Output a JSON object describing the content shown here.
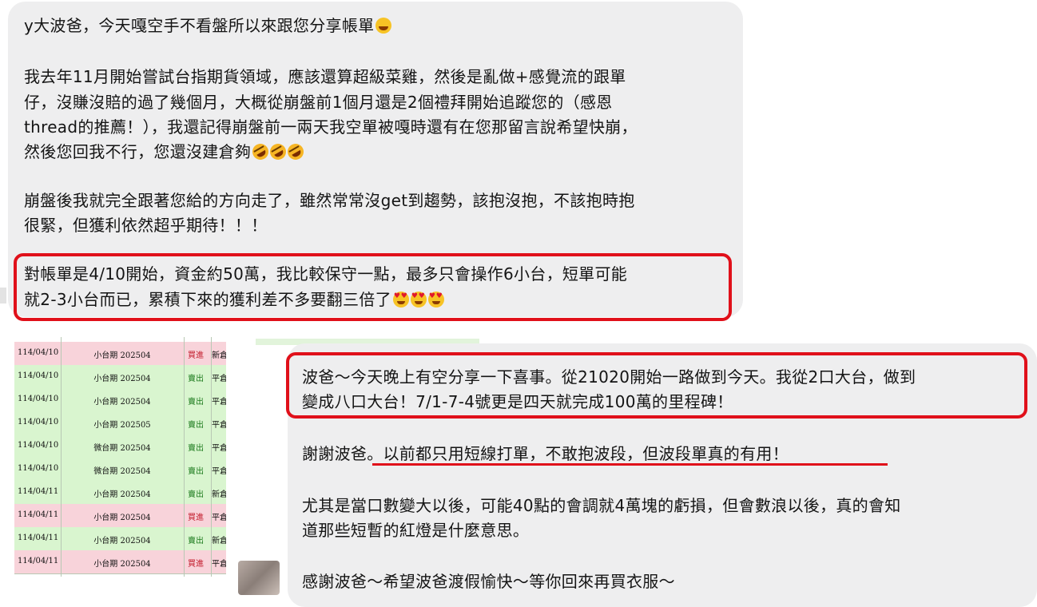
{
  "message1": {
    "lines": [
      "y大波爸，今天嘎空手不看盤所以來跟您分享帳單",
      "我去年11月開始嘗試台指期貨領域，應該還算超級菜雞，然後是亂做+感覺流的跟單",
      "仔，沒賺沒賠的過了幾個月，大概從崩盤前1個月還是2個禮拜開始追蹤您的（感恩",
      "thread的推薦！），我還記得崩盤前一兩天我空單被嘎時還有在您那留言說希望快崩，",
      "然後您回我不行，您還沒建倉夠",
      "崩盤後我就完全跟著您給的方向走了，雖然常常沒get到趨勢，該抱沒抱，不該抱時抱",
      "很緊，但獲利依然超乎期待！！！",
      "對帳單是4/10開始，資金約50萬，我比較保守一點，最多只會操作6小台，短單可能",
      "就2-3小台而已，累積下來的獲利差不多要翻三倍了"
    ]
  },
  "message2": {
    "lines": [
      "波爸～今天晚上有空分享一下喜事。從21020開始一路做到今天。我從2口大台，做到",
      "變成八口大台！7/1-7-4號更是四天就完成100萬的里程碑！",
      "謝謝波爸。以前都只用短線打單，不敢抱波段，但波段單真的有用！",
      "尤其是當口數變大以後，可能40點的會調就4萬塊的虧損，但會數浪以後，真的會知",
      "道那些短暫的紅燈是什麼意思。",
      "感謝波爸～希望波爸渡假愉快～等你回來再買衣服～"
    ]
  },
  "sheet": {
    "rows": [
      {
        "date": "114/04/10",
        "product": "小台期 202504",
        "side": "買進",
        "kind": "新倉",
        "color": "pink"
      },
      {
        "date": "114/04/10",
        "product": "小台期 202504",
        "side": "賣出",
        "kind": "平倉",
        "color": "green"
      },
      {
        "date": "114/04/10",
        "product": "小台期 202504",
        "side": "賣出",
        "kind": "平倉",
        "color": "green"
      },
      {
        "date": "114/04/10",
        "product": "小台期 202505",
        "side": "賣出",
        "kind": "平倉",
        "color": "green"
      },
      {
        "date": "114/04/10",
        "product": "微台期 202504",
        "side": "賣出",
        "kind": "平倉",
        "color": "green"
      },
      {
        "date": "114/04/10",
        "product": "微台期 202504",
        "side": "賣出",
        "kind": "平倉",
        "color": "green"
      },
      {
        "date": "114/04/11",
        "product": "小台期 202504",
        "side": "賣出",
        "kind": "新倉",
        "color": "green"
      },
      {
        "date": "114/04/11",
        "product": "小台期 202504",
        "side": "買進",
        "kind": "平倉",
        "color": "pink"
      },
      {
        "date": "114/04/11",
        "product": "小台期 202504",
        "side": "賣出",
        "kind": "新倉",
        "color": "green"
      },
      {
        "date": "114/04/11",
        "product": "小台期 202504",
        "side": "買進",
        "kind": "平倉",
        "color": "pink"
      }
    ]
  },
  "emojis": {
    "grin": "grinning-squinting-face-icon",
    "rofl": "rolling-on-floor-laughing-icon",
    "hearteyes": "smiling-face-with-heart-eyes-icon"
  },
  "colors": {
    "bubble": "#eeeeef",
    "highlight": "#e0101a",
    "buy_row": "#f8d3da",
    "sell_row": "#d9f5cf"
  }
}
